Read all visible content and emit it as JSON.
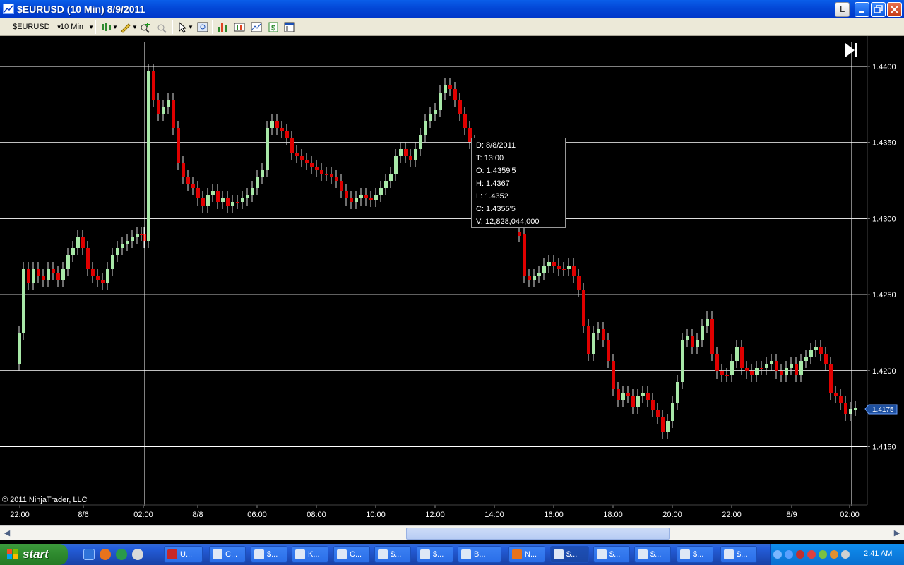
{
  "window": {
    "title": "$EURUSD (10 Min)  8/9/2011",
    "l_button": "L",
    "minimize": "_",
    "restore": "❐",
    "close": "✕"
  },
  "toolbar": {
    "instrument": "$EURUSD",
    "interval": "10 Min"
  },
  "chart": {
    "copyright": "© 2011 NinjaTrader, LLC",
    "price_labels": [
      "1.4400",
      "1.4350",
      "1.4300",
      "1.4250",
      "1.4200",
      "1.4150"
    ],
    "current_price": "1.4175",
    "time_labels": [
      "22:00",
      "8/6",
      "02:00",
      "8/8",
      "06:00",
      "08:00",
      "10:00",
      "12:00",
      "14:00",
      "16:00",
      "18:00",
      "20:00",
      "22:00",
      "8/9",
      "02:00"
    ],
    "colors": {
      "up": "#a8e8a8",
      "down": "#e00000",
      "grid": "#ffffff",
      "background": "#000000",
      "current_price_bg": "#1e50a0"
    },
    "tooltip": {
      "date": "D: 8/8/2011",
      "time": "T: 13:00",
      "open": "O: 1.4359'5",
      "high": "H: 1.4367",
      "low": "L: 1.4352",
      "close": "C: 1.4355'5",
      "volume": "V: 12,828,044,000"
    }
  },
  "scrollbar": {
    "left_arrow": "◀",
    "right_arrow": "▶"
  },
  "taskbar": {
    "start": "start",
    "tasks": [
      {
        "label": "U...",
        "icon": "ib-icon"
      },
      {
        "label": "C...",
        "icon": "chart-icon"
      },
      {
        "label": "$...",
        "icon": "chart-icon"
      },
      {
        "label": "K...",
        "icon": "chart-icon"
      },
      {
        "label": "C...",
        "icon": "chart-icon"
      },
      {
        "label": "$...",
        "icon": "chart-icon"
      },
      {
        "label": "$...",
        "icon": "chart-icon"
      },
      {
        "label": "B...",
        "icon": "chart-icon"
      },
      {
        "label": "N...",
        "icon": "firefox-icon"
      },
      {
        "label": "$...",
        "icon": "chart-icon"
      },
      {
        "label": "$...",
        "icon": "chart-icon"
      },
      {
        "label": "$...",
        "icon": "chart-icon"
      },
      {
        "label": "$...",
        "icon": "chart-icon"
      },
      {
        "label": "$...",
        "icon": "chart-icon"
      }
    ],
    "clock": "2:41 AM"
  }
}
